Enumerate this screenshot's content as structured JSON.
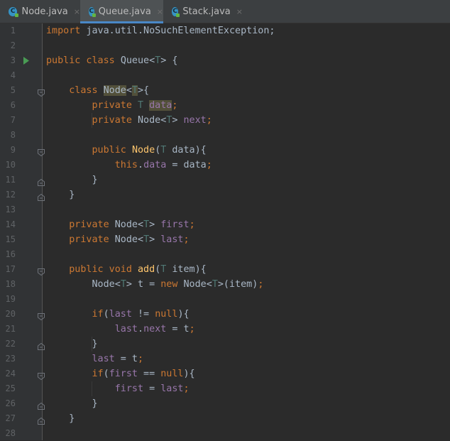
{
  "tabs": [
    {
      "name": "Node.java",
      "active": false
    },
    {
      "name": "Queue.java",
      "active": true
    },
    {
      "name": "Stack.java",
      "active": false
    }
  ],
  "tab_icon_letter": "C",
  "close_glyph": "×",
  "lines": [
    {
      "n": "1",
      "gutter": "",
      "fold": "",
      "tokens": [
        [
          "kw",
          "import "
        ],
        [
          "pl",
          "java.util.NoSuchElementException;"
        ]
      ]
    },
    {
      "n": "2",
      "gutter": "",
      "fold": "",
      "tokens": []
    },
    {
      "n": "3",
      "gutter": "run",
      "fold": "",
      "tokens": [
        [
          "kw",
          "public class "
        ],
        [
          "pl",
          "Queue<"
        ],
        [
          "tp",
          "T"
        ],
        [
          "pl",
          "> {"
        ]
      ]
    },
    {
      "n": "4",
      "gutter": "",
      "fold": "",
      "tokens": []
    },
    {
      "n": "5",
      "gutter": "",
      "fold": "open",
      "tokens": [
        [
          "pl",
          "    "
        ],
        [
          "kw",
          "class "
        ],
        [
          "hl",
          "Node"
        ],
        [
          "pl",
          "<"
        ],
        [
          "tphl",
          "T"
        ],
        [
          "pl",
          ">{"
        ]
      ]
    },
    {
      "n": "6",
      "gutter": "",
      "fold": "",
      "tokens": [
        [
          "pl",
          "        "
        ],
        [
          "kw",
          "private "
        ],
        [
          "tp",
          "T "
        ],
        [
          "fldhl",
          "data"
        ],
        [
          "kw",
          ";"
        ]
      ]
    },
    {
      "n": "7",
      "gutter": "",
      "fold": "",
      "tokens": [
        [
          "pl",
          "        "
        ],
        [
          "kw",
          "private "
        ],
        [
          "pl",
          "Node<"
        ],
        [
          "tp",
          "T"
        ],
        [
          "pl",
          "> "
        ],
        [
          "fld",
          "next"
        ],
        [
          "kw",
          ";"
        ]
      ]
    },
    {
      "n": "8",
      "gutter": "",
      "fold": "",
      "tokens": []
    },
    {
      "n": "9",
      "gutter": "",
      "fold": "open",
      "tokens": [
        [
          "pl",
          "        "
        ],
        [
          "kw",
          "public "
        ],
        [
          "fn",
          "Node"
        ],
        [
          "pl",
          "("
        ],
        [
          "tp",
          "T "
        ],
        [
          "pl",
          "data){"
        ]
      ]
    },
    {
      "n": "10",
      "gutter": "",
      "fold": "",
      "tokens": [
        [
          "pl",
          "            "
        ],
        [
          "kw",
          "this"
        ],
        [
          "pl",
          "."
        ],
        [
          "fld",
          "data"
        ],
        [
          "pl",
          " = data"
        ],
        [
          "kw",
          ";"
        ]
      ]
    },
    {
      "n": "11",
      "gutter": "",
      "fold": "close",
      "tokens": [
        [
          "pl",
          "        }"
        ]
      ]
    },
    {
      "n": "12",
      "gutter": "",
      "fold": "close",
      "tokens": [
        [
          "pl",
          "    }"
        ]
      ]
    },
    {
      "n": "13",
      "gutter": "",
      "fold": "",
      "tokens": []
    },
    {
      "n": "14",
      "gutter": "",
      "fold": "",
      "tokens": [
        [
          "pl",
          "    "
        ],
        [
          "kw",
          "private "
        ],
        [
          "pl",
          "Node<"
        ],
        [
          "tp",
          "T"
        ],
        [
          "pl",
          "> "
        ],
        [
          "fld",
          "first"
        ],
        [
          "kw",
          ";"
        ]
      ]
    },
    {
      "n": "15",
      "gutter": "",
      "fold": "",
      "tokens": [
        [
          "pl",
          "    "
        ],
        [
          "kw",
          "private "
        ],
        [
          "pl",
          "Node<"
        ],
        [
          "tp",
          "T"
        ],
        [
          "pl",
          "> "
        ],
        [
          "fld",
          "last"
        ],
        [
          "kw",
          ";"
        ]
      ]
    },
    {
      "n": "16",
      "gutter": "",
      "fold": "",
      "tokens": []
    },
    {
      "n": "17",
      "gutter": "",
      "fold": "open",
      "tokens": [
        [
          "pl",
          "    "
        ],
        [
          "kw",
          "public void "
        ],
        [
          "fn",
          "add"
        ],
        [
          "pl",
          "("
        ],
        [
          "tp",
          "T "
        ],
        [
          "pl",
          "item){"
        ]
      ]
    },
    {
      "n": "18",
      "gutter": "",
      "fold": "",
      "tokens": [
        [
          "pl",
          "        Node<"
        ],
        [
          "tp",
          "T"
        ],
        [
          "pl",
          "> t = "
        ],
        [
          "kw",
          "new "
        ],
        [
          "pl",
          "Node<"
        ],
        [
          "tp",
          "T"
        ],
        [
          "pl",
          ">(item)"
        ],
        [
          "kw",
          ";"
        ]
      ]
    },
    {
      "n": "19",
      "gutter": "",
      "fold": "",
      "tokens": []
    },
    {
      "n": "20",
      "gutter": "",
      "fold": "open",
      "tokens": [
        [
          "pl",
          "        "
        ],
        [
          "kw",
          "if"
        ],
        [
          "pl",
          "("
        ],
        [
          "fld",
          "last"
        ],
        [
          "pl",
          " != "
        ],
        [
          "kw",
          "null"
        ],
        [
          "pl",
          "){"
        ]
      ]
    },
    {
      "n": "21",
      "gutter": "",
      "fold": "",
      "tokens": [
        [
          "pl",
          "            "
        ],
        [
          "fld",
          "last"
        ],
        [
          "pl",
          "."
        ],
        [
          "fld",
          "next"
        ],
        [
          "pl",
          " = t"
        ],
        [
          "kw",
          ";"
        ]
      ]
    },
    {
      "n": "22",
      "gutter": "",
      "fold": "close",
      "tokens": [
        [
          "pl",
          "        }"
        ]
      ]
    },
    {
      "n": "23",
      "gutter": "",
      "fold": "",
      "tokens": [
        [
          "pl",
          "        "
        ],
        [
          "fld",
          "last"
        ],
        [
          "pl",
          " = t"
        ],
        [
          "kw",
          ";"
        ]
      ]
    },
    {
      "n": "24",
      "gutter": "",
      "fold": "open",
      "tokens": [
        [
          "pl",
          "        "
        ],
        [
          "kw",
          "if"
        ],
        [
          "pl",
          "("
        ],
        [
          "fld",
          "first"
        ],
        [
          "pl",
          " == "
        ],
        [
          "kw",
          "null"
        ],
        [
          "pl",
          "){"
        ]
      ]
    },
    {
      "n": "25",
      "gutter": "",
      "fold": "",
      "tokens": [
        [
          "pl",
          "            "
        ],
        [
          "fld",
          "first"
        ],
        [
          "pl",
          " = "
        ],
        [
          "fld",
          "last"
        ],
        [
          "kw",
          ";"
        ]
      ]
    },
    {
      "n": "26",
      "gutter": "",
      "fold": "close",
      "tokens": [
        [
          "pl",
          "        }"
        ]
      ]
    },
    {
      "n": "27",
      "gutter": "",
      "fold": "close",
      "tokens": [
        [
          "pl",
          "    }"
        ]
      ]
    },
    {
      "n": "28",
      "gutter": "",
      "fold": "",
      "tokens": []
    }
  ],
  "colors": {
    "background": "#2b2b2b",
    "keyword": "#cc7832",
    "type_param": "#507874",
    "field": "#9876aa",
    "method": "#ffc66d",
    "plain": "#a9b7c6",
    "accent": "#4a88c7"
  }
}
